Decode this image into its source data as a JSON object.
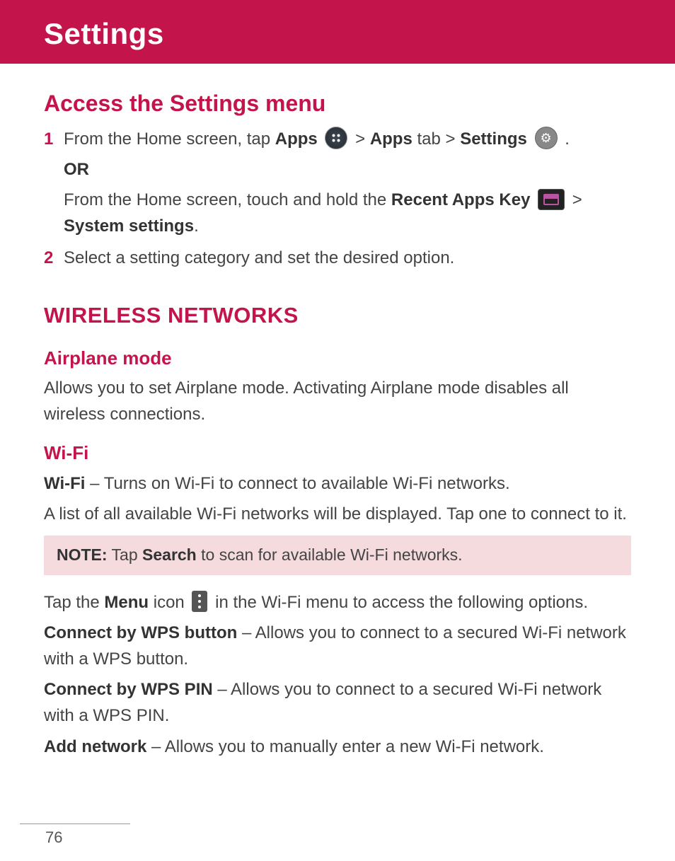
{
  "header": {
    "title": "Settings"
  },
  "section1": {
    "heading": "Access the Settings menu",
    "steps": [
      {
        "num": "1",
        "line1_pre": "From the Home screen, tap ",
        "line1_apps": "Apps",
        "line1_gt1": " > ",
        "line1_appstab_b": "Apps",
        "line1_appstab_after": " tab > ",
        "line1_settings": "Settings",
        "line1_end": " .",
        "or": "OR",
        "line2_pre": "From the Home screen, touch and hold the ",
        "line2_recent": "Recent Apps Key",
        "line2_gt": " > ",
        "line2_sys": "System settings",
        "line2_end": "."
      },
      {
        "num": "2",
        "text": "Select a setting category and set the desired option."
      }
    ]
  },
  "section2": {
    "heading": "WIRELESS NETWORKS",
    "airplane": {
      "heading": "Airplane mode",
      "text": "Allows you to set Airplane mode. Activating Airplane mode disables all wireless connections."
    },
    "wifi": {
      "heading": "Wi-Fi",
      "line1_b": "Wi-Fi",
      "line1_rest": " – Turns on Wi-Fi to connect to available Wi-Fi networks.",
      "line2": "A list of all available Wi-Fi networks will be displayed. Tap one to connect to it.",
      "note_label": "NOTE:",
      "note_pre": " Tap ",
      "note_search": "Search",
      "note_rest": " to scan for available Wi-Fi networks.",
      "menu_pre": "Tap the ",
      "menu_b": "Menu",
      "menu_mid": " icon ",
      "menu_rest": " in the Wi-Fi menu to access the following options.",
      "opt1_b": "Connect by WPS button",
      "opt1_rest": " – Allows you to connect to a secured Wi-Fi network with a WPS button.",
      "opt2_b": "Connect by WPS PIN",
      "opt2_rest": " – Allows you to connect to a secured Wi-Fi network with a WPS PIN.",
      "opt3_b": "Add network",
      "opt3_rest": " – Allows you to manually enter a new Wi-Fi network."
    }
  },
  "page_number": "76"
}
